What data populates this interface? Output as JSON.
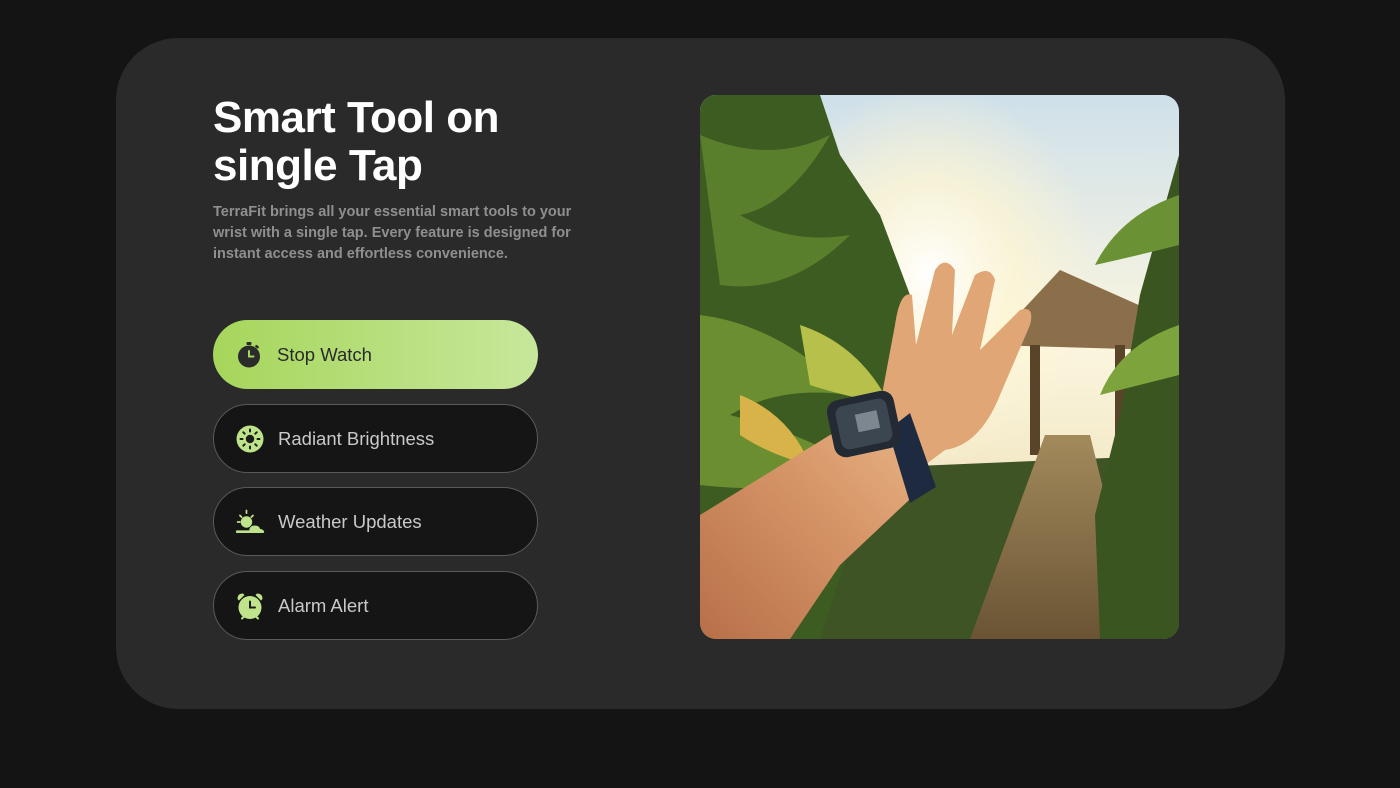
{
  "hero": {
    "title": "Smart Tool on single Tap",
    "description": "TerraFit brings all your essential smart tools to your wrist with a single tap. Every feature is designed for instant access and effortless convenience."
  },
  "features": [
    {
      "label": "Stop Watch",
      "icon": "stopwatch-icon",
      "active": true
    },
    {
      "label": "Radiant Brightness",
      "icon": "sun-icon",
      "active": false
    },
    {
      "label": "Weather Updates",
      "icon": "weather-icon",
      "active": false
    },
    {
      "label": "Alarm Alert",
      "icon": "alarm-clock-icon",
      "active": false
    }
  ],
  "colors": {
    "page_background": "#141414",
    "card_background": "#2a2a2a",
    "accent_green": "#a6d65b",
    "accent_green_light": "#c7e79b",
    "pill_background": "#151515",
    "text_white": "#ffffff",
    "text_muted": "#8f8f8f"
  },
  "photo": {
    "subject": "raised-hand-with-smartwatch-in-tropical-garden"
  }
}
